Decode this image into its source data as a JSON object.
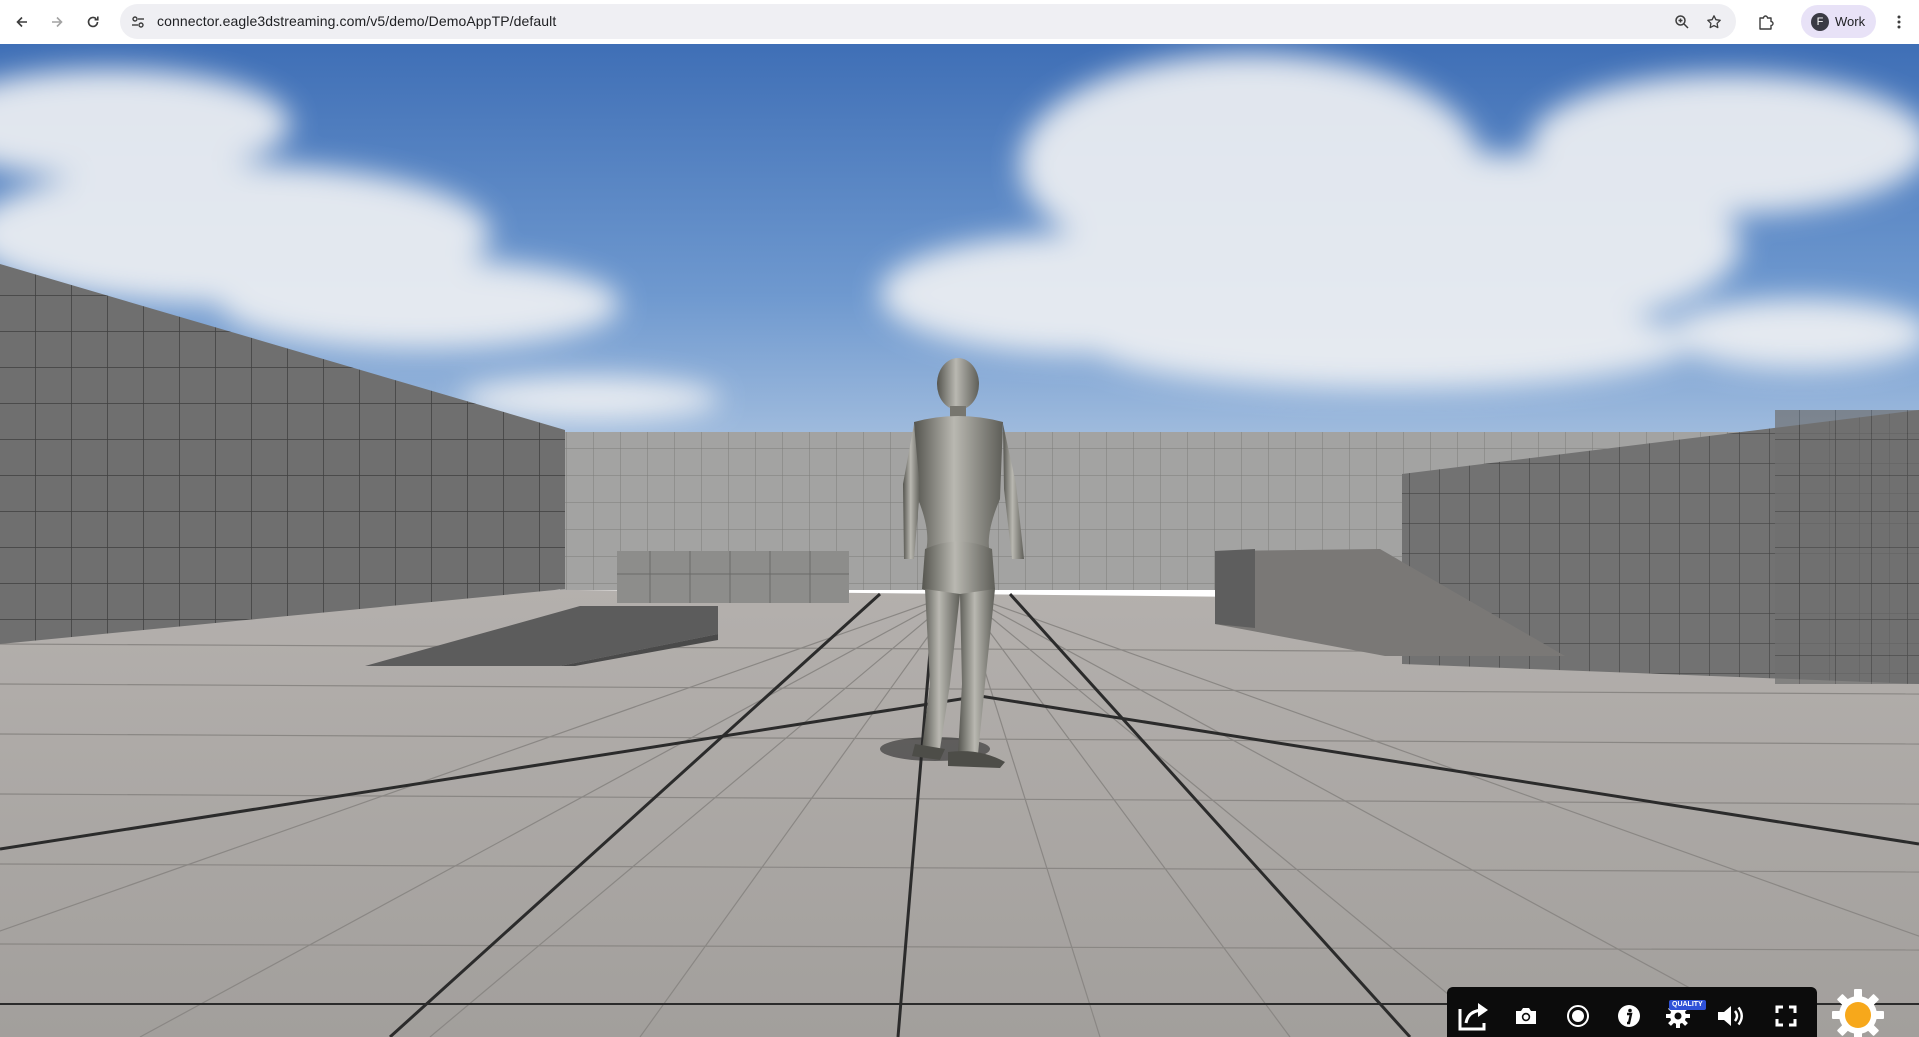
{
  "browser": {
    "url": "connector.eagle3dstreaming.com/v5/demo/DemoAppTP/default",
    "profile_initial": "F",
    "profile_name": "Work"
  },
  "controls": {
    "quality_badge": "QUALITY"
  },
  "icons": {
    "back": "back-arrow-icon",
    "forward": "forward-arrow-icon",
    "reload": "reload-icon",
    "site_info": "tune-icon",
    "zoom": "zoom-icon",
    "bookmark": "star-icon",
    "extensions": "puzzle-icon",
    "menu": "kebab-menu-icon",
    "share": "share-icon",
    "screenshot": "camera-icon",
    "record": "record-icon",
    "info": "info-icon",
    "quality": "gear-icon",
    "volume": "volume-icon",
    "fullscreen": "fullscreen-icon",
    "settings": "gear-icon"
  },
  "colors": {
    "accent_orange": "#f7a81b",
    "quality_badge": "#2f52d8",
    "control_bar": "#0c0c0c"
  }
}
